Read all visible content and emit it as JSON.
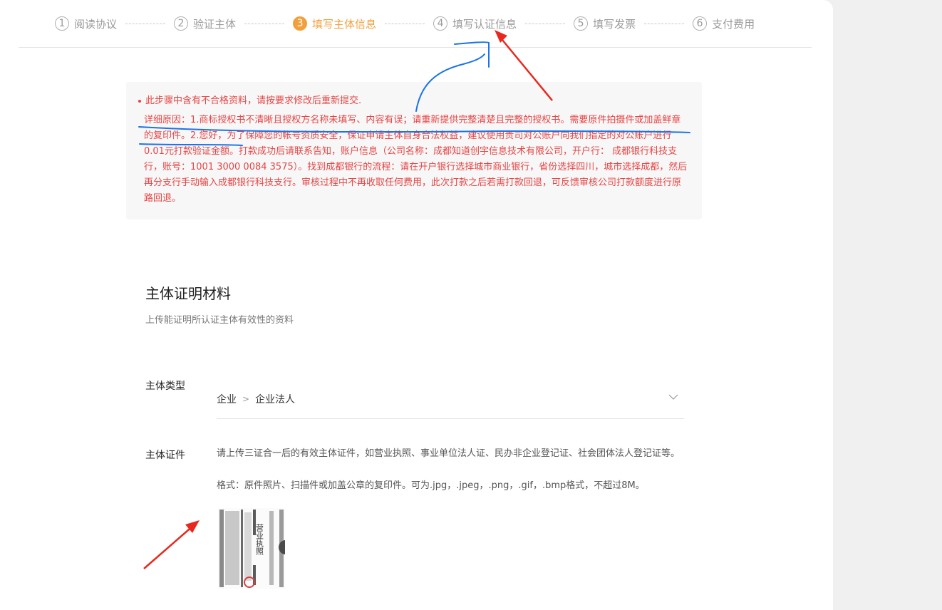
{
  "steps": [
    {
      "num": "1",
      "label": "阅读协议"
    },
    {
      "num": "2",
      "label": "验证主体"
    },
    {
      "num": "3",
      "label": "填写主体信息"
    },
    {
      "num": "4",
      "label": "填写认证信息"
    },
    {
      "num": "5",
      "label": "填写发票"
    },
    {
      "num": "6",
      "label": "支付费用"
    }
  ],
  "active_step": 3,
  "error": {
    "headline": "此步骤中含有不合格资料，请按要求修改后重新提交.",
    "detail": "详细原因：1.商标授权书不清晰且授权方名称未填写、内容有误；请重新提供完整清楚且完整的授权书。需要原件拍摄件或加盖鲜章的复印件。2.您好，为了保障您的帐号资质安全，保证申请主体自身合法权益，建议使用贵司对公账户向我们指定的对公账户进行0.01元打款验证金额。打款成功后请联系告知，账户信息（公司名称：成都知道创宇信息技术有限公司，开户行： 成都银行科技支行，账号：1001 3000 0084 3575）。找到成都银行的流程：请在开户银行选择城市商业银行，省份选择四川，城市选择成都，然后再分支行手动输入成都银行科技支行。审核过程中不再收取任何费用，此次打款之后若需打款回退，可反馈审核公司打款额度进行原路回退。"
  },
  "section": {
    "title": "主体证明材料",
    "description": "上传能证明所认证主体有效性的资料"
  },
  "subject_type": {
    "label": "主体类型",
    "level1": "企业",
    "level2": "企业法人"
  },
  "certificate": {
    "label": "主体证件",
    "description": "请上传三证合一后的有效主体证件，如营业执照、事业单位法人证、民办非企业登记证、社会团体法人登记证等。",
    "format": "格式：原件照片、扫描件或加盖公章的复印件。可为.jpg，.jpeg，.png，.gif，.bmp格式，不超过8M。",
    "thumbnail_text": "营业执照"
  },
  "colors": {
    "accent": "#f2a03d",
    "error": "#e64545",
    "annotation_blue": "#1a73e8",
    "annotation_red": "#e8281e"
  }
}
